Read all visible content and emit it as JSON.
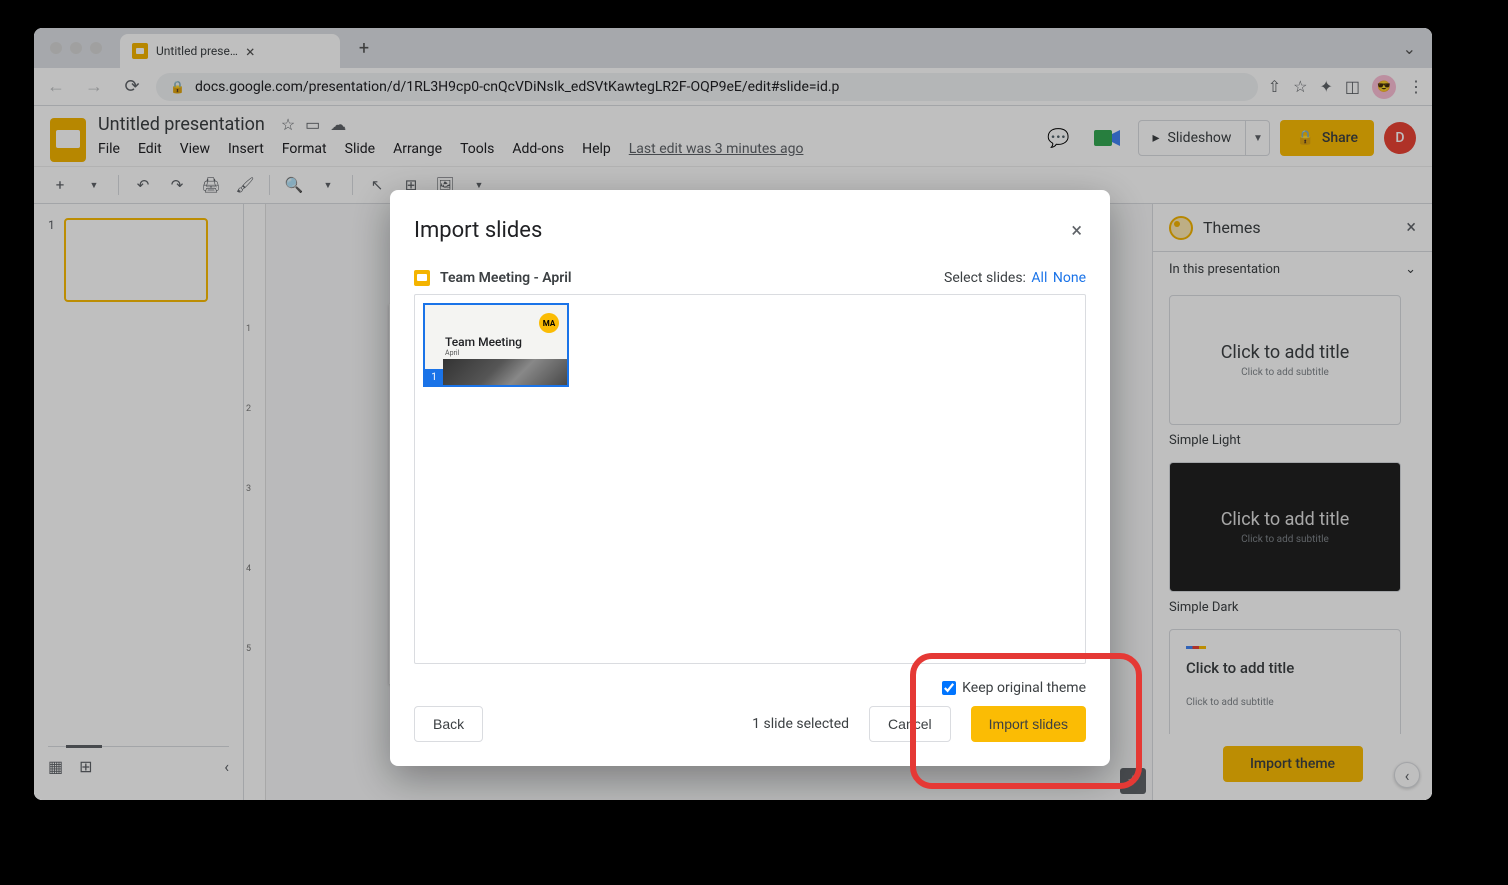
{
  "browser": {
    "tab_title": "Untitled presentation - Google",
    "url": "docs.google.com/presentation/d/1RL3H9cp0-cnQcVDiNsIk_edSVtKawtegLR2F-OQP9eE/edit#slide=id.p"
  },
  "header": {
    "doc_title": "Untitled presentation",
    "menus": [
      "File",
      "Edit",
      "View",
      "Insert",
      "Format",
      "Slide",
      "Arrange",
      "Tools",
      "Add-ons",
      "Help"
    ],
    "last_edit": "Last edit was 3 minutes ago",
    "slideshow_label": "Slideshow",
    "share_label": "Share",
    "avatar_letter": "D"
  },
  "filmstrip": {
    "slides": [
      {
        "num": "1"
      }
    ]
  },
  "themes": {
    "title": "Themes",
    "in_presentation": "In this presentation",
    "card_title": "Click to add title",
    "card_subtitle": "Click to add subtitle",
    "names": [
      "Simple Light",
      "Simple Dark"
    ],
    "import_label": "Import theme"
  },
  "modal": {
    "title": "Import slides",
    "source": "Team Meeting - April",
    "select_prefix": "Select slides:",
    "select_all": "All",
    "select_none": "None",
    "thumb_title": "Team Meeting",
    "thumb_sub": "April",
    "thumb_badge": "MA",
    "thumb_num": "1",
    "keep_theme": "Keep original theme",
    "back": "Back",
    "selected": "1 slide selected",
    "cancel": "Cancel",
    "import": "Import slides"
  }
}
